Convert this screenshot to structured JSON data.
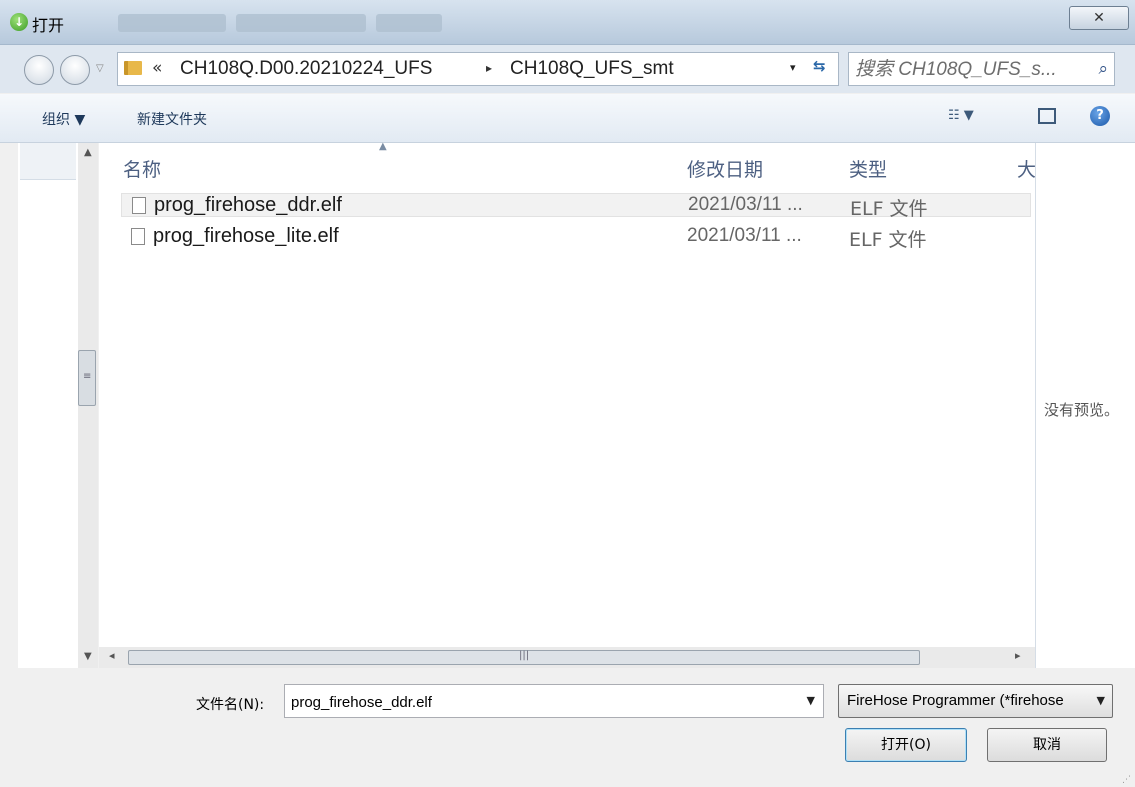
{
  "window": {
    "title": "打开",
    "close_glyph": "✕"
  },
  "address": {
    "overflow_glyph": "«",
    "crumbs": [
      "CH108Q.D00.20210224_UFS",
      "CH108Q_UFS_smt"
    ],
    "separator": "▸",
    "dropdown_glyph": "▾",
    "refresh_glyph": "⇆",
    "search_placeholder": "搜索 CH108Q_UFS_s..."
  },
  "toolbar": {
    "organize_label": "组织 ▼",
    "new_folder_label": "新建文件夹",
    "view_glyph": "☷ ▼",
    "help_glyph": "?"
  },
  "file_list": {
    "columns": {
      "name": "名称",
      "date": "修改日期",
      "type": "类型",
      "size": "大"
    },
    "rows": [
      {
        "name": "prog_firehose_ddr.elf",
        "date": "2021/03/11 ...",
        "type": "ELF 文件"
      },
      {
        "name": "prog_firehose_lite.elf",
        "date": "2021/03/11 ...",
        "type": "ELF 文件"
      }
    ]
  },
  "preview": {
    "empty_text": "没有预览。"
  },
  "bottom": {
    "filename_label": "文件名(N):",
    "filename_value": "prog_firehose_ddr.elf",
    "filetype_value": "FireHose Programmer (*firehose",
    "open_label": "打开(O)",
    "cancel_label": "取消"
  },
  "icons": {
    "title": "open-dialog-icon",
    "folder": "folder-icon",
    "file": "file-icon",
    "search": "search-icon",
    "help": "help-icon"
  }
}
